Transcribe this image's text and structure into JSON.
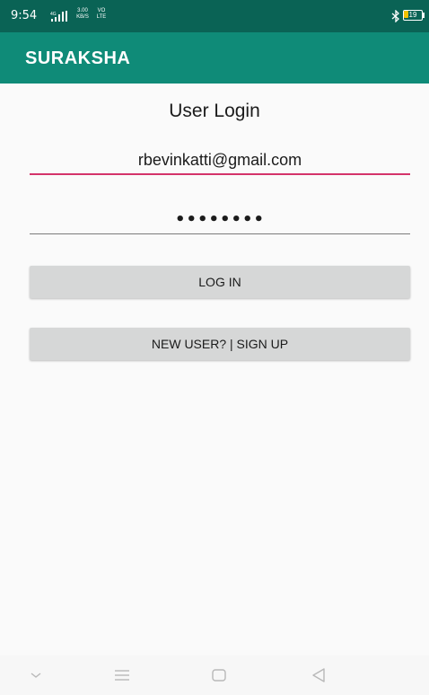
{
  "status_bar": {
    "time": "9:54",
    "network_rate": "3.00",
    "network_rate_unit": "KB/S",
    "volte_top": "VO",
    "volte_bottom": "LTE",
    "bluetooth_icon": "bluetooth-icon",
    "battery_level": "19",
    "battery_color": "#f3c200"
  },
  "app_bar": {
    "title": "SURAKSHA",
    "color": "#0f8b78",
    "status_color": "#0a6355"
  },
  "login": {
    "heading": "User Login",
    "email_value": "rbevinkatti@gmail.com",
    "password_value": "••••••••",
    "accent_color": "#d4336a"
  },
  "buttons": {
    "login_label": "LOG IN",
    "signup_label": "NEW USER? | SIGN UP"
  },
  "nav_bar": {
    "icons": [
      "chevron-down-icon",
      "menu-icon",
      "home-icon",
      "back-icon"
    ]
  }
}
